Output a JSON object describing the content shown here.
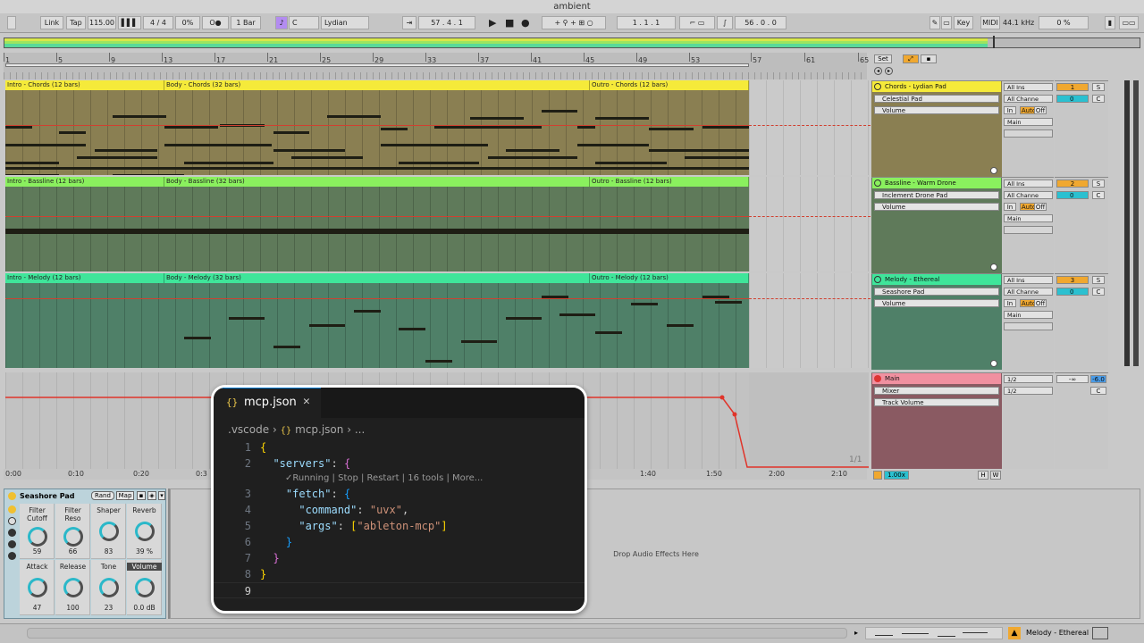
{
  "window": {
    "title": "ambient"
  },
  "transport": {
    "link": "Link",
    "tap": "Tap",
    "tempo": "115.00",
    "meter_num": "4",
    "meter_sep": "/",
    "meter_den": "4",
    "swing": "0%",
    "quantize": "1 Bar",
    "key": "C",
    "scale": "Lydian",
    "position": "57 .  4 .  1",
    "loop_start": "1 .  1 .  1",
    "loop_length": "56 .  0 .  0",
    "key_label": "Key",
    "midi_label": "MIDI",
    "sample_rate": "44.1 kHz",
    "cpu": "0 %"
  },
  "ruler": {
    "bars": [
      "1",
      "5",
      "9",
      "13",
      "17",
      "21",
      "25",
      "29",
      "33",
      "37",
      "41",
      "45",
      "49",
      "53",
      "57",
      "61",
      "65"
    ],
    "set_label": "Set"
  },
  "tracks": [
    {
      "name": "Chords - Lydian Pad",
      "color": "#f5ea3a",
      "lane_color": "#8a7f52",
      "clips": [
        "Intro - Chords (12 bars)",
        "Body - Chords (32 bars)",
        "Outro - Chords (12 bars)"
      ],
      "instrument": "Celestial Pad",
      "param": "Volume",
      "input": "All Ins",
      "channel": "All Channe",
      "monitor": [
        "In",
        "Auto",
        "Off"
      ],
      "output": "Main",
      "number": "1",
      "solo": "S",
      "volume": "0",
      "pan": "C"
    },
    {
      "name": "Bassline - Warm Drone",
      "color": "#8af05e",
      "lane_color": "#5f7a5a",
      "clips": [
        "Intro - Bassline (12 bars)",
        "Body - Bassline (32 bars)",
        "Outro - Bassline (12 bars)"
      ],
      "instrument": "Inclement Drone Pad",
      "param": "Volume",
      "input": "All Ins",
      "channel": "All Channe",
      "monitor": [
        "In",
        "Auto",
        "Off"
      ],
      "output": "Main",
      "number": "2",
      "solo": "S",
      "volume": "0",
      "pan": "C"
    },
    {
      "name": "Melody - Ethereal",
      "color": "#3fe59a",
      "lane_color": "#4f8068",
      "clips": [
        "Intro - Melody (12 bars)",
        "Body - Melody (32 bars)",
        "Outro - Melody (12 bars)"
      ],
      "instrument": "Seashore Pad",
      "param": "Volume",
      "input": "All Ins",
      "channel": "All Channe",
      "monitor": [
        "In",
        "Auto",
        "Off"
      ],
      "output": "Main",
      "number": "3",
      "solo": "S",
      "volume": "0",
      "pan": "C"
    }
  ],
  "main_track": {
    "name": "Main",
    "color": "#f090a0",
    "device": "Mixer",
    "param": "Track Volume",
    "io1": "1/2",
    "io2": "1/2",
    "volume_db": "-6.0",
    "inf": "-∞",
    "pan": "C",
    "page": "1/1",
    "zoom": "1.00x",
    "h_btn": "H",
    "w_btn": "W"
  },
  "time_ruler": [
    "0:00",
    "0:10",
    "0:20",
    "0:3",
    "1:40",
    "1:50",
    "2:00",
    "2:10"
  ],
  "device": {
    "title": "Seashore Pad",
    "rand": "Rand",
    "map": "Map",
    "knobs": [
      {
        "label": "Filter\nCutoff",
        "value": "59"
      },
      {
        "label": "Filter\nReso",
        "value": "66"
      },
      {
        "label": "Shaper",
        "value": "83"
      },
      {
        "label": "Reverb",
        "value": "39 %"
      },
      {
        "label": "Attack",
        "value": "47"
      },
      {
        "label": "Release",
        "value": "100"
      },
      {
        "label": "Tone",
        "value": "23"
      },
      {
        "label": "Volume",
        "value": "0.0 dB"
      }
    ]
  },
  "drop_zone": "Drop Audio Effects Here",
  "status": {
    "track": "Melody - Ethereal"
  },
  "vscode": {
    "tab": "mcp.json",
    "tab_icon": "{}",
    "breadcrumb": [
      ".vscode",
      "{}",
      "mcp.json",
      "..."
    ],
    "codelens": "Running | Stop | Restart | 16 tools | More...",
    "lines": [
      "1",
      "2",
      "3",
      "4",
      "5",
      "6",
      "7",
      "8",
      "9"
    ],
    "servers_key": "\"servers\"",
    "fetch_key": "\"fetch\"",
    "command_key": "\"command\"",
    "command_val": "\"uvx\"",
    "args_key": "\"args\"",
    "args_val": "\"ableton-mcp\""
  }
}
